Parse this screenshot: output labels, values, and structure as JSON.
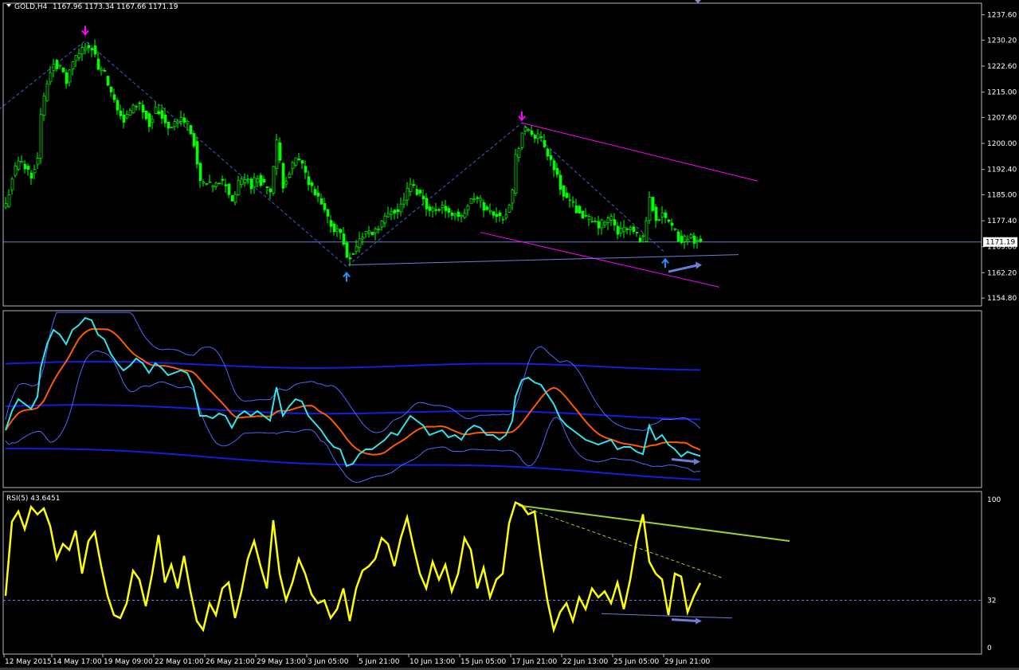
{
  "header": {
    "symbol_label": "GOLD,H4",
    "ohlc_text": "1167.96 1173.34 1167.66 1171.19"
  },
  "rsi_label": "RSI(5) 43.6451",
  "colors": {
    "background": "#000000",
    "bull_candle": "#00ff00",
    "bear_candle": "#00ff00",
    "zigzag": "#3f5fcf",
    "channel": "#ff00ff",
    "support_line": "#6b7fd7",
    "price_line": "#6b7fd7",
    "bb_outer": "#1020e0",
    "bb_inner": "#4a68ff",
    "ma_fast": "#32e6f0",
    "ma_slow": "#ff5a00",
    "rsi": "#ffff00",
    "rsi_trend": "#9acd32",
    "arrow_down": "#ff00ff",
    "arrow_up": "#1e90ff"
  },
  "chart_data": {
    "type": "candlestick",
    "title": "GOLD,H4",
    "price_axis": {
      "ylim": [
        1152.5,
        1241.0
      ],
      "ticks": [
        "1237.60",
        "1230.20",
        "1222.60",
        "1215.00",
        "1207.60",
        "1200.00",
        "1192.40",
        "1185.00",
        "1177.40",
        "1169.80",
        "1162.20",
        "1154.80"
      ],
      "tick_values": [
        1237.6,
        1230.2,
        1222.6,
        1215.0,
        1207.6,
        1200.0,
        1192.4,
        1185.0,
        1177.4,
        1169.8,
        1162.2,
        1154.8
      ],
      "current_price_label": "1171.19",
      "current_price": 1171.19
    },
    "time_axis": {
      "labels": [
        "12 May 2015",
        "14 May 17:00",
        "19 May 09:00",
        "22 May 01:00",
        "26 May 21:00",
        "29 May 13:00",
        "3 Jun 05:00",
        "5 Jun 21:00",
        "10 Jun 13:00",
        "15 Jun 05:00",
        "17 Jun 21:00",
        "22 Jun 13:00",
        "25 Jun 05:00",
        "29 Jun 21:00"
      ],
      "label_index": [
        0,
        15,
        31,
        47,
        63,
        79,
        95,
        111,
        127,
        143,
        159,
        175,
        191,
        207
      ]
    },
    "close_anchors": [
      [
        0,
        1182
      ],
      [
        2,
        1190
      ],
      [
        4,
        1195
      ],
      [
        6,
        1193
      ],
      [
        8,
        1191
      ],
      [
        10,
        1196
      ],
      [
        11,
        1208
      ],
      [
        13,
        1218
      ],
      [
        15,
        1224
      ],
      [
        17,
        1222
      ],
      [
        19,
        1218
      ],
      [
        21,
        1224
      ],
      [
        23,
        1226
      ],
      [
        25,
        1229
      ],
      [
        27,
        1228
      ],
      [
        29,
        1222
      ],
      [
        31,
        1220
      ],
      [
        33,
        1214
      ],
      [
        35,
        1210
      ],
      [
        37,
        1207
      ],
      [
        39,
        1209
      ],
      [
        41,
        1212
      ],
      [
        43,
        1210
      ],
      [
        45,
        1206
      ],
      [
        47,
        1210
      ],
      [
        49,
        1208
      ],
      [
        51,
        1205
      ],
      [
        53,
        1206
      ],
      [
        55,
        1207
      ],
      [
        57,
        1206
      ],
      [
        59,
        1200
      ],
      [
        61,
        1188
      ],
      [
        63,
        1188
      ],
      [
        65,
        1187
      ],
      [
        67,
        1189
      ],
      [
        69,
        1188
      ],
      [
        71,
        1183
      ],
      [
        73,
        1188
      ],
      [
        75,
        1190
      ],
      [
        77,
        1188
      ],
      [
        79,
        1190
      ],
      [
        81,
        1188
      ],
      [
        83,
        1186
      ],
      [
        85,
        1200
      ],
      [
        87,
        1188
      ],
      [
        89,
        1192
      ],
      [
        91,
        1195
      ],
      [
        93,
        1194
      ],
      [
        95,
        1188
      ],
      [
        97,
        1185
      ],
      [
        99,
        1182
      ],
      [
        101,
        1178
      ],
      [
        103,
        1175
      ],
      [
        105,
        1174
      ],
      [
        107,
        1167
      ],
      [
        109,
        1168
      ],
      [
        111,
        1172
      ],
      [
        113,
        1174
      ],
      [
        115,
        1174
      ],
      [
        117,
        1176
      ],
      [
        119,
        1178
      ],
      [
        121,
        1181
      ],
      [
        123,
        1180
      ],
      [
        125,
        1184
      ],
      [
        127,
        1188
      ],
      [
        129,
        1186
      ],
      [
        131,
        1184
      ],
      [
        133,
        1180
      ],
      [
        135,
        1181
      ],
      [
        137,
        1182
      ],
      [
        139,
        1179
      ],
      [
        141,
        1180
      ],
      [
        143,
        1178
      ],
      [
        145,
        1182
      ],
      [
        147,
        1184
      ],
      [
        149,
        1183
      ],
      [
        151,
        1180
      ],
      [
        153,
        1180
      ],
      [
        155,
        1178
      ],
      [
        157,
        1180
      ],
      [
        159,
        1186
      ],
      [
        160,
        1196
      ],
      [
        162,
        1203
      ],
      [
        164,
        1204
      ],
      [
        166,
        1202
      ],
      [
        168,
        1201
      ],
      [
        170,
        1197
      ],
      [
        172,
        1193
      ],
      [
        174,
        1187
      ],
      [
        176,
        1184
      ],
      [
        178,
        1182
      ],
      [
        180,
        1180
      ],
      [
        182,
        1178
      ],
      [
        184,
        1177
      ],
      [
        186,
        1176
      ],
      [
        188,
        1177
      ],
      [
        190,
        1178
      ],
      [
        192,
        1174
      ],
      [
        194,
        1175
      ],
      [
        196,
        1175
      ],
      [
        198,
        1173
      ],
      [
        200,
        1172
      ],
      [
        202,
        1184
      ],
      [
        204,
        1178
      ],
      [
        206,
        1180
      ],
      [
        208,
        1176
      ],
      [
        210,
        1174
      ],
      [
        212,
        1171
      ],
      [
        214,
        1173
      ],
      [
        216,
        1172
      ],
      [
        218,
        1171.19
      ]
    ],
    "zigzag": [
      [
        -2,
        1210
      ],
      [
        25,
        1230
      ],
      [
        107,
        1164
      ],
      [
        162,
        1206
      ],
      [
        207,
        1168
      ]
    ],
    "arrows": [
      {
        "type": "down",
        "i": 25,
        "price": 1233
      },
      {
        "type": "up",
        "i": 107,
        "price": 1161
      },
      {
        "type": "down",
        "i": 162,
        "price": 1208
      },
      {
        "type": "up",
        "i": 207,
        "price": 1165
      }
    ],
    "channel_upper": [
      [
        162,
        1206
      ],
      [
        236,
        1189
      ]
    ],
    "channel_lower": [
      [
        149,
        1174
      ],
      [
        224,
        1158
      ]
    ],
    "support_line": [
      [
        108,
        1164.5
      ],
      [
        230,
        1167.5
      ]
    ],
    "price_arrow": [
      [
        208,
        1162.5
      ],
      [
        218,
        1164.5
      ]
    ],
    "indicator_panel": {
      "ylim": [
        0,
        100
      ],
      "bb_outer_upper": [
        [
          0,
          70
        ],
        [
          218,
          68
        ]
      ],
      "bb_outer_lower": [
        [
          0,
          22
        ],
        [
          218,
          6
        ]
      ],
      "bb_mid": [
        [
          0,
          46
        ],
        [
          218,
          40
        ]
      ]
    },
    "rsi_panel": {
      "label": "RSI(5) 43.6451",
      "value": 43.6451,
      "ylim": [
        0,
        100
      ],
      "ticks": [
        "100",
        "32",
        "0"
      ],
      "tick_values": [
        100,
        32,
        0
      ],
      "trend_upper": [
        [
          161,
          96
        ],
        [
          246,
          72
        ]
      ],
      "trend_dashed": [
        [
          161,
          96
        ],
        [
          225,
          47
        ]
      ],
      "trend_lower": [
        [
          187,
          23
        ],
        [
          228,
          20
        ]
      ],
      "arrow": [
        [
          209,
          19
        ],
        [
          218,
          18
        ]
      ],
      "anchors": [
        [
          0,
          35
        ],
        [
          2,
          85
        ],
        [
          4,
          92
        ],
        [
          6,
          80
        ],
        [
          8,
          95
        ],
        [
          10,
          90
        ],
        [
          12,
          94
        ],
        [
          14,
          82
        ],
        [
          16,
          60
        ],
        [
          18,
          70
        ],
        [
          20,
          66
        ],
        [
          22,
          79
        ],
        [
          24,
          50
        ],
        [
          26,
          72
        ],
        [
          28,
          78
        ],
        [
          30,
          55
        ],
        [
          32,
          35
        ],
        [
          34,
          22
        ],
        [
          36,
          20
        ],
        [
          38,
          30
        ],
        [
          40,
          52
        ],
        [
          42,
          46
        ],
        [
          44,
          28
        ],
        [
          46,
          50
        ],
        [
          48,
          76
        ],
        [
          50,
          44
        ],
        [
          52,
          56
        ],
        [
          54,
          40
        ],
        [
          56,
          62
        ],
        [
          58,
          38
        ],
        [
          60,
          18
        ],
        [
          62,
          12
        ],
        [
          64,
          30
        ],
        [
          66,
          22
        ],
        [
          68,
          40
        ],
        [
          70,
          44
        ],
        [
          72,
          20
        ],
        [
          74,
          38
        ],
        [
          76,
          60
        ],
        [
          78,
          72
        ],
        [
          80,
          55
        ],
        [
          82,
          40
        ],
        [
          84,
          86
        ],
        [
          86,
          50
        ],
        [
          88,
          32
        ],
        [
          90,
          44
        ],
        [
          92,
          60
        ],
        [
          94,
          50
        ],
        [
          96,
          36
        ],
        [
          98,
          30
        ],
        [
          100,
          32
        ],
        [
          102,
          20
        ],
        [
          104,
          26
        ],
        [
          106,
          40
        ],
        [
          108,
          18
        ],
        [
          110,
          40
        ],
        [
          112,
          52
        ],
        [
          114,
          55
        ],
        [
          116,
          60
        ],
        [
          118,
          74
        ],
        [
          120,
          70
        ],
        [
          122,
          55
        ],
        [
          124,
          74
        ],
        [
          126,
          88
        ],
        [
          128,
          68
        ],
        [
          130,
          50
        ],
        [
          132,
          40
        ],
        [
          134,
          58
        ],
        [
          136,
          46
        ],
        [
          138,
          56
        ],
        [
          140,
          38
        ],
        [
          142,
          50
        ],
        [
          144,
          74
        ],
        [
          146,
          66
        ],
        [
          148,
          40
        ],
        [
          150,
          54
        ],
        [
          152,
          34
        ],
        [
          154,
          46
        ],
        [
          156,
          50
        ],
        [
          158,
          84
        ],
        [
          160,
          98
        ],
        [
          162,
          96
        ],
        [
          164,
          90
        ],
        [
          166,
          92
        ],
        [
          168,
          60
        ],
        [
          170,
          32
        ],
        [
          172,
          12
        ],
        [
          174,
          24
        ],
        [
          176,
          30
        ],
        [
          178,
          18
        ],
        [
          180,
          34
        ],
        [
          182,
          26
        ],
        [
          184,
          40
        ],
        [
          186,
          34
        ],
        [
          188,
          38
        ],
        [
          190,
          30
        ],
        [
          192,
          44
        ],
        [
          194,
          26
        ],
        [
          196,
          46
        ],
        [
          198,
          72
        ],
        [
          200,
          90
        ],
        [
          202,
          58
        ],
        [
          204,
          50
        ],
        [
          206,
          46
        ],
        [
          208,
          22
        ],
        [
          210,
          50
        ],
        [
          212,
          48
        ],
        [
          214,
          24
        ],
        [
          216,
          35
        ],
        [
          218,
          43.6451
        ]
      ]
    }
  }
}
